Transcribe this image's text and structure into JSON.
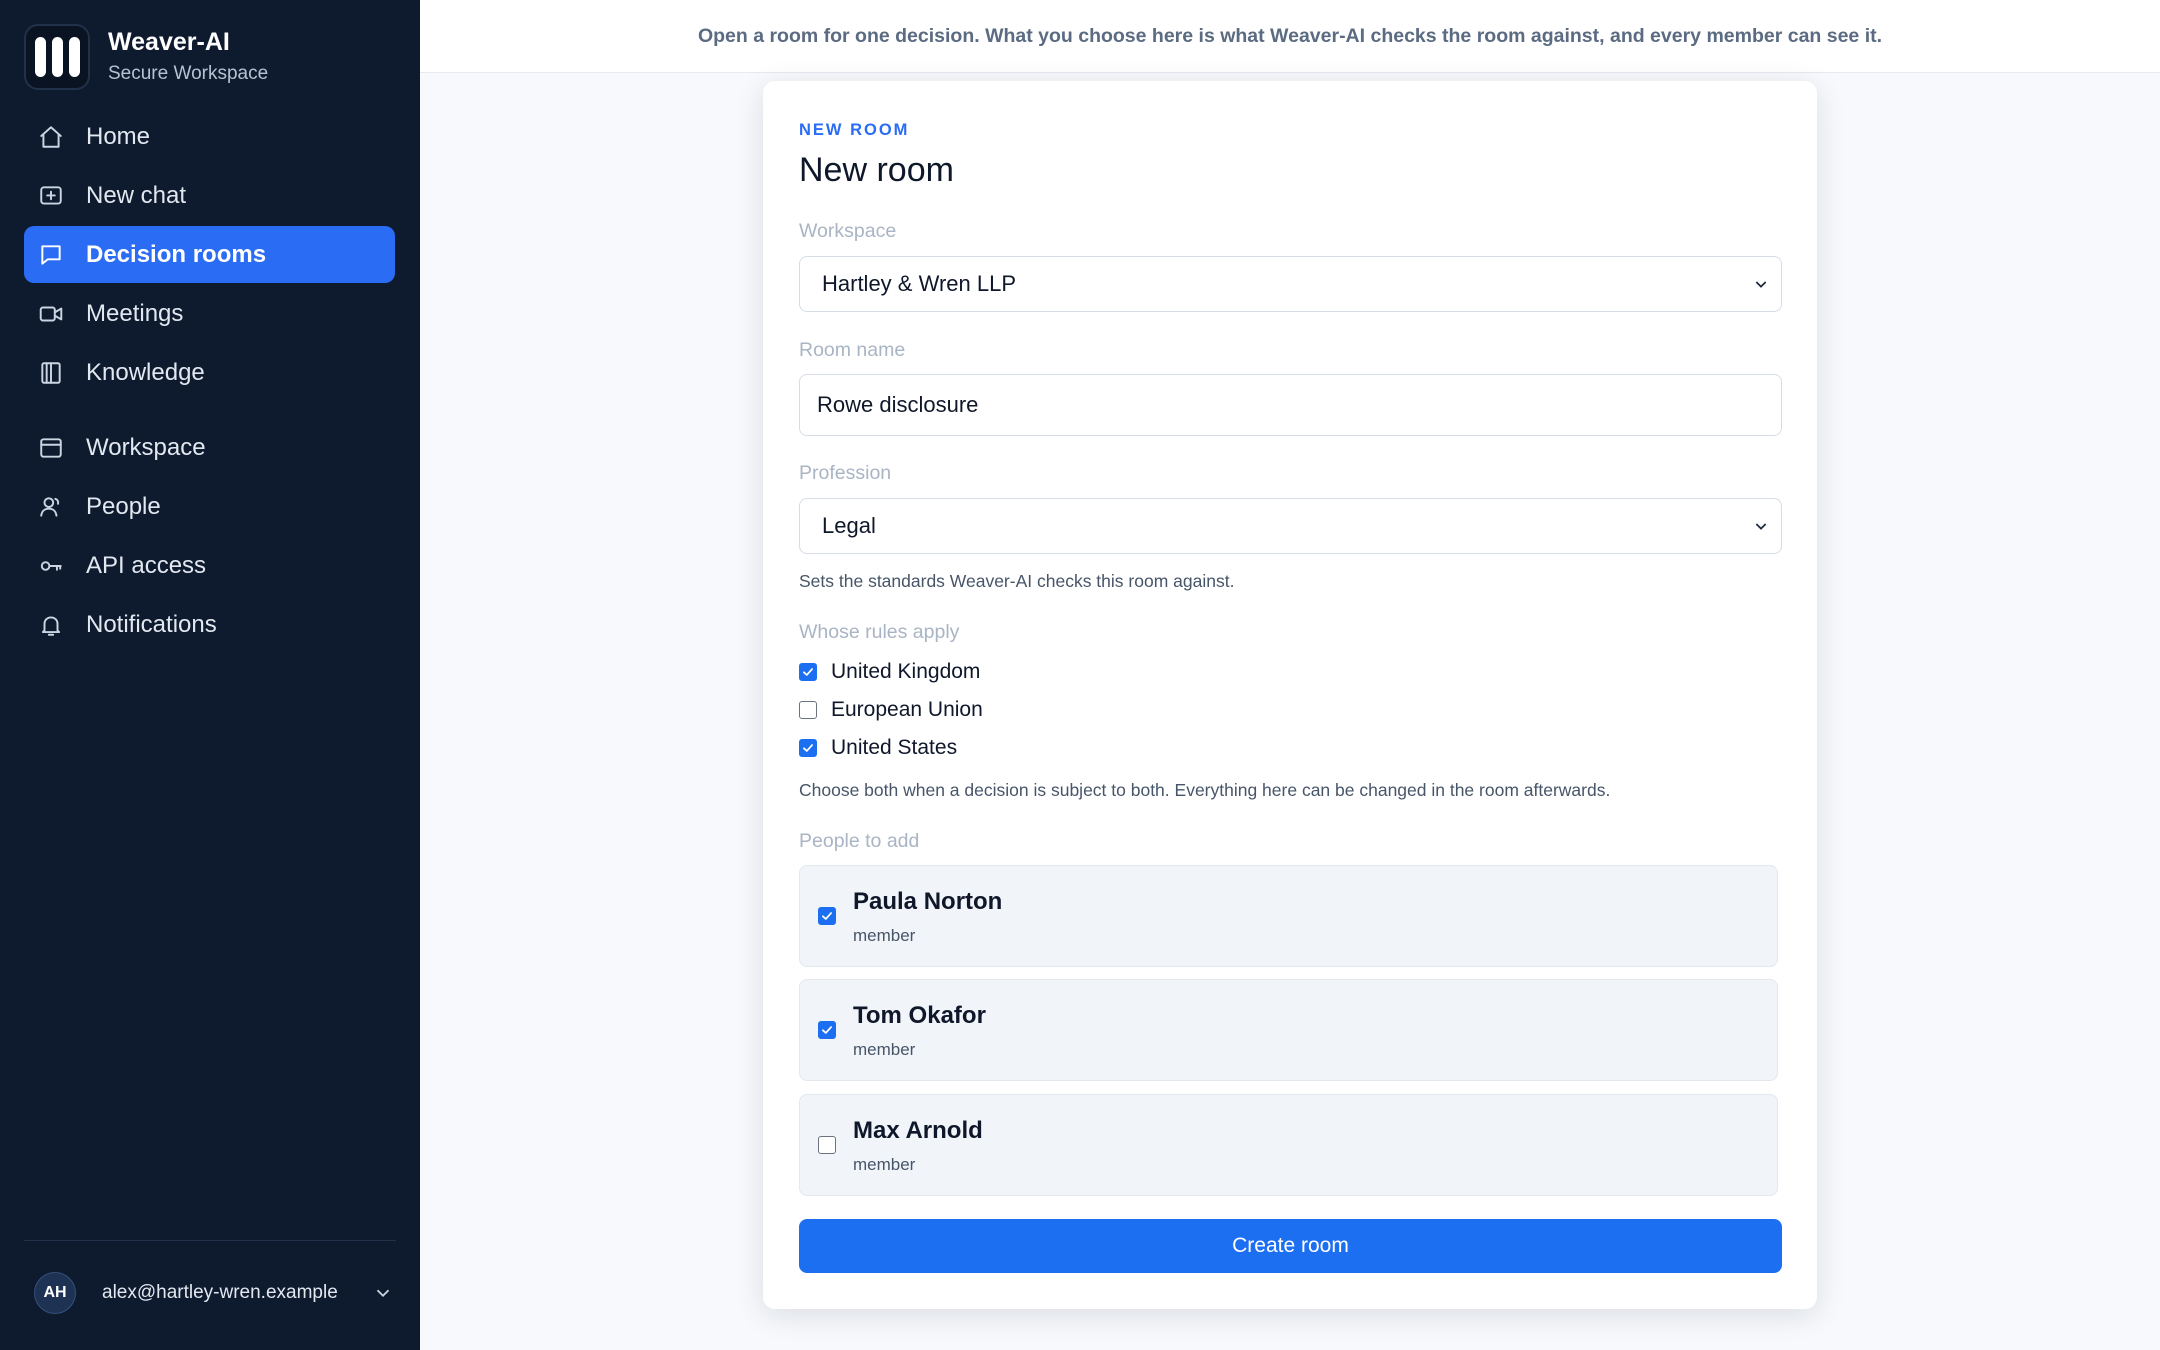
{
  "app": {
    "name": "Weaver-AI",
    "subtitle": "Secure Workspace"
  },
  "sidebar": {
    "items": [
      {
        "label": "Home",
        "icon": "home-icon"
      },
      {
        "label": "New chat",
        "icon": "new-chat-icon"
      },
      {
        "label": "Decision rooms",
        "icon": "chat-bubble-icon",
        "active": true
      },
      {
        "label": "Meetings",
        "icon": "video-camera-icon"
      },
      {
        "label": "Knowledge",
        "icon": "book-icon"
      },
      {
        "label": "Workspace",
        "icon": "window-icon"
      },
      {
        "label": "People",
        "icon": "person-icon"
      },
      {
        "label": "API access",
        "icon": "key-icon"
      },
      {
        "label": "Notifications",
        "icon": "bell-icon"
      }
    ],
    "user": {
      "initials": "AH",
      "email": "alex@hartley-wren.example"
    }
  },
  "topbar": {
    "text": "Open a room for one decision. What you choose here is what Weaver-AI checks the room against, and every member can see it."
  },
  "form": {
    "eyebrow": "NEW ROOM",
    "title": "New room",
    "workspace_label": "Workspace",
    "workspace_value": "Hartley & Wren LLP",
    "room_name_label": "Room name",
    "room_name_value": "Rowe disclosure",
    "profession_label": "Profession",
    "profession_value": "Legal",
    "profession_hint": "Sets the standards Weaver-AI checks this room against.",
    "rules_label": "Whose rules apply",
    "rules": [
      {
        "label": "United Kingdom",
        "checked": true
      },
      {
        "label": "European Union",
        "checked": false
      },
      {
        "label": "United States",
        "checked": true
      }
    ],
    "rules_hint": "Choose both when a decision is subject to both. Everything here can be changed in the room afterwards.",
    "people_label": "People to add",
    "people": [
      {
        "name": "Paula Norton",
        "role": "member",
        "checked": true
      },
      {
        "name": "Tom Okafor",
        "role": "member",
        "checked": true
      },
      {
        "name": "Max Arnold",
        "role": "member",
        "checked": false
      }
    ],
    "submit_label": "Create room"
  },
  "colors": {
    "sidebar_bg": "#0e1a2e",
    "accent": "#2a6df4",
    "button": "#1d6ff2"
  }
}
